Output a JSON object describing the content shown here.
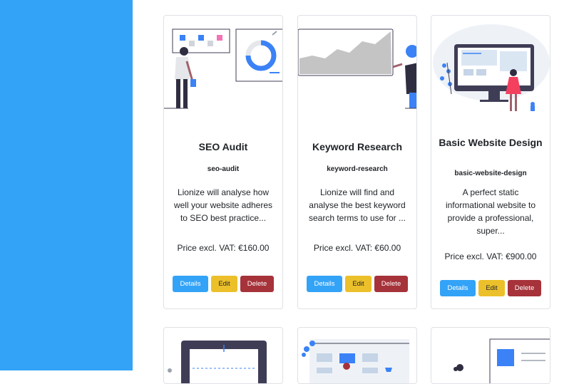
{
  "cards": [
    {
      "title": "SEO Audit",
      "slug": "seo-audit",
      "description": "Lionize will analyse how well your website adheres to SEO best practice...",
      "price": "Price excl. VAT: €160.00",
      "illustration": "person-at-whiteboard-with-chart"
    },
    {
      "title": "Keyword Research",
      "slug": "keyword-research",
      "description": "Lionize will find and analyse the best keyword search terms to use for ...",
      "price": "Price excl. VAT: €60.00",
      "illustration": "area-chart-with-person"
    },
    {
      "title": "Basic Website Design",
      "slug": "basic-website-design",
      "description": "A perfect static informational website to provide a professional, super...",
      "price": "Price excl. VAT: €900.00",
      "illustration": "person-at-monitor"
    }
  ],
  "buttons": {
    "details": "Details",
    "edit": "Edit",
    "delete": "Delete"
  },
  "bottom_cards": [
    {
      "illustration": "browser-window-with-cursor"
    },
    {
      "illustration": "online-shop-with-person"
    },
    {
      "illustration": "person-with-web-page"
    }
  ],
  "colors": {
    "sidebar": "#33a3f7",
    "details_button": "#33a3f7",
    "edit_button": "#ecc02a",
    "delete_button": "#a6323a"
  }
}
